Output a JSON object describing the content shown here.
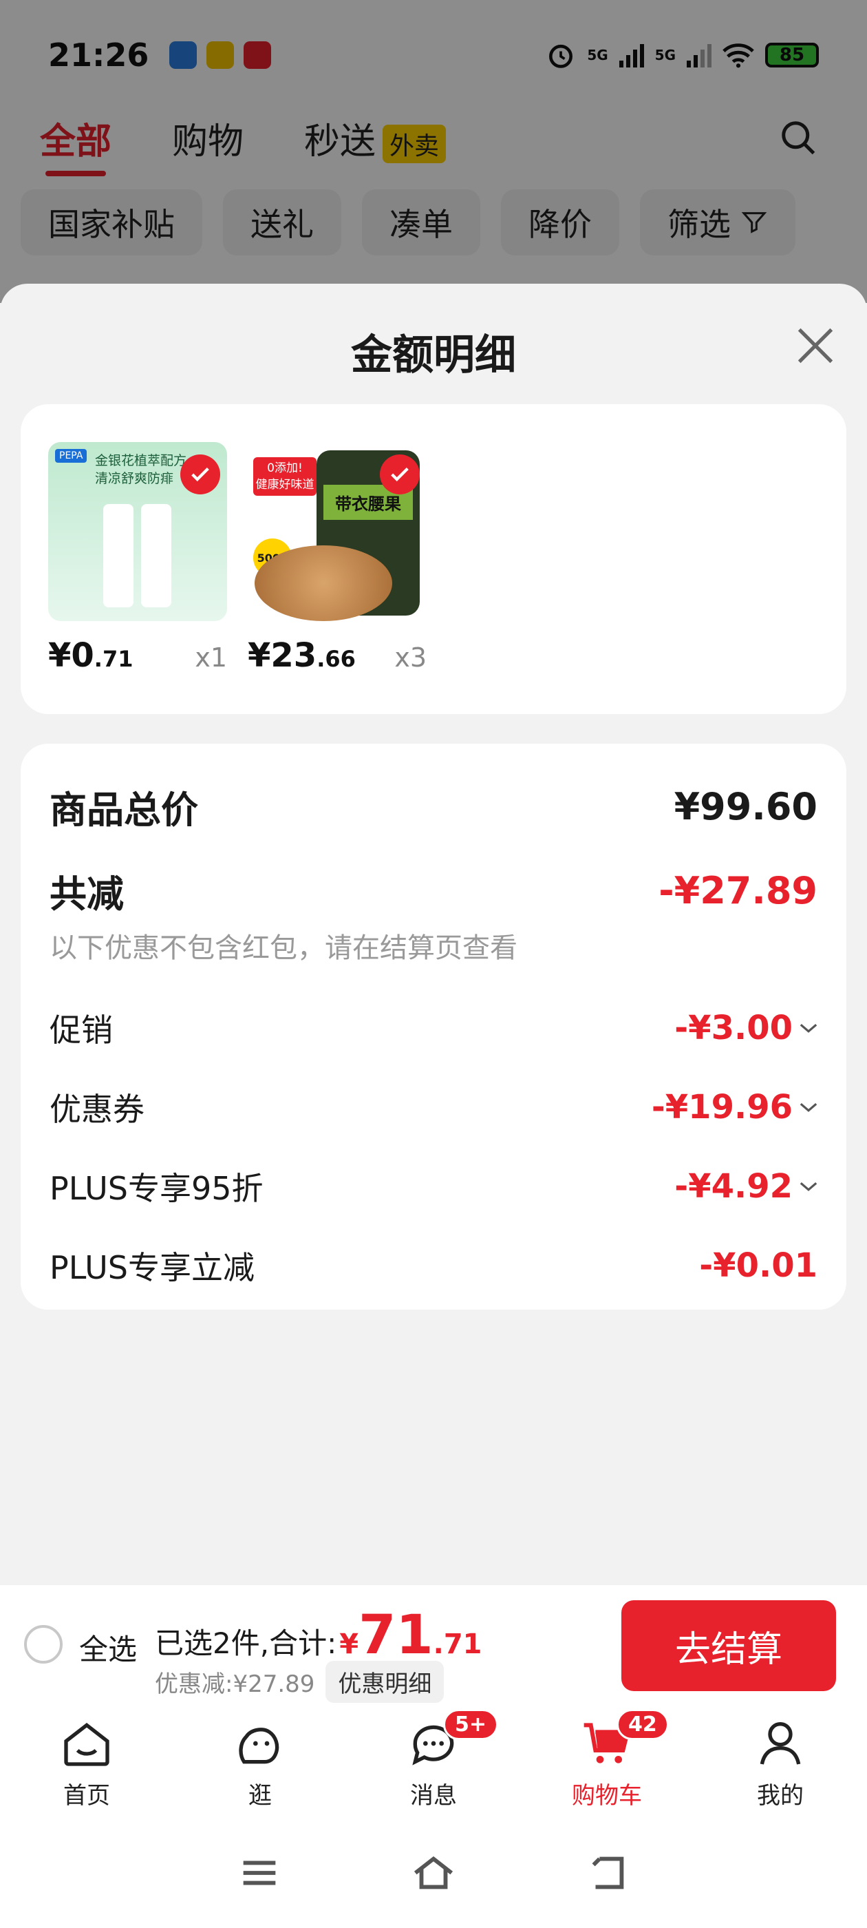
{
  "status_bar": {
    "time": "21:26",
    "battery": "85",
    "net1": "5G",
    "net2": "5G"
  },
  "top_tabs": {
    "all": "全部",
    "shopping": "购物",
    "flash": "秒送",
    "flash_badge": "外卖"
  },
  "chips": [
    "国家补贴",
    "送礼",
    "凑单",
    "降价",
    "筛选"
  ],
  "sheet": {
    "title": "金额明细"
  },
  "products": [
    {
      "price_int": "¥0",
      "price_dec": ".71",
      "qty": "x1",
      "img_text_1": "金银花植萃配方",
      "img_text_2": "清凉舒爽防痱",
      "brand": "PEPA"
    },
    {
      "price_int": "¥23",
      "price_dec": ".66",
      "qty": "x3",
      "img_text_1": "0添加!",
      "img_text_2": "健康好味道",
      "img_text_3": "500g",
      "jar_label": "带衣腰果"
    }
  ],
  "summary": {
    "total_label": "商品总价",
    "total_value": "¥99.60",
    "reduce_label": "共减",
    "reduce_value": "-¥27.89",
    "note": "以下优惠不包含红包，请在结算页查看",
    "items": [
      {
        "label": "促销",
        "value": "-¥3.00",
        "expandable": true
      },
      {
        "label": "优惠券",
        "value": "-¥19.96",
        "expandable": true
      },
      {
        "label": "PLUS专享95折",
        "value": "-¥4.92",
        "expandable": true
      },
      {
        "label": "PLUS专享立减",
        "value": "-¥0.01",
        "expandable": false
      }
    ]
  },
  "checkout": {
    "select_all": "全选",
    "selected_text": "已选2件,合计:",
    "currency": "¥",
    "total_int": "71",
    "total_dec": ".71",
    "discount_text": "优惠减:¥27.89",
    "detail_button": "优惠明细",
    "pay_button": "去结算"
  },
  "tabbar": [
    {
      "label": "首页",
      "icon": "home-icon"
    },
    {
      "label": "逛",
      "icon": "browse-icon"
    },
    {
      "label": "消息",
      "icon": "message-icon",
      "badge": "5+"
    },
    {
      "label": "购物车",
      "icon": "cart-icon",
      "badge": "42",
      "active": true
    },
    {
      "label": "我的",
      "icon": "profile-icon"
    }
  ],
  "colors": {
    "accent": "#e8222d",
    "badge_yellow": "#ffd200"
  }
}
